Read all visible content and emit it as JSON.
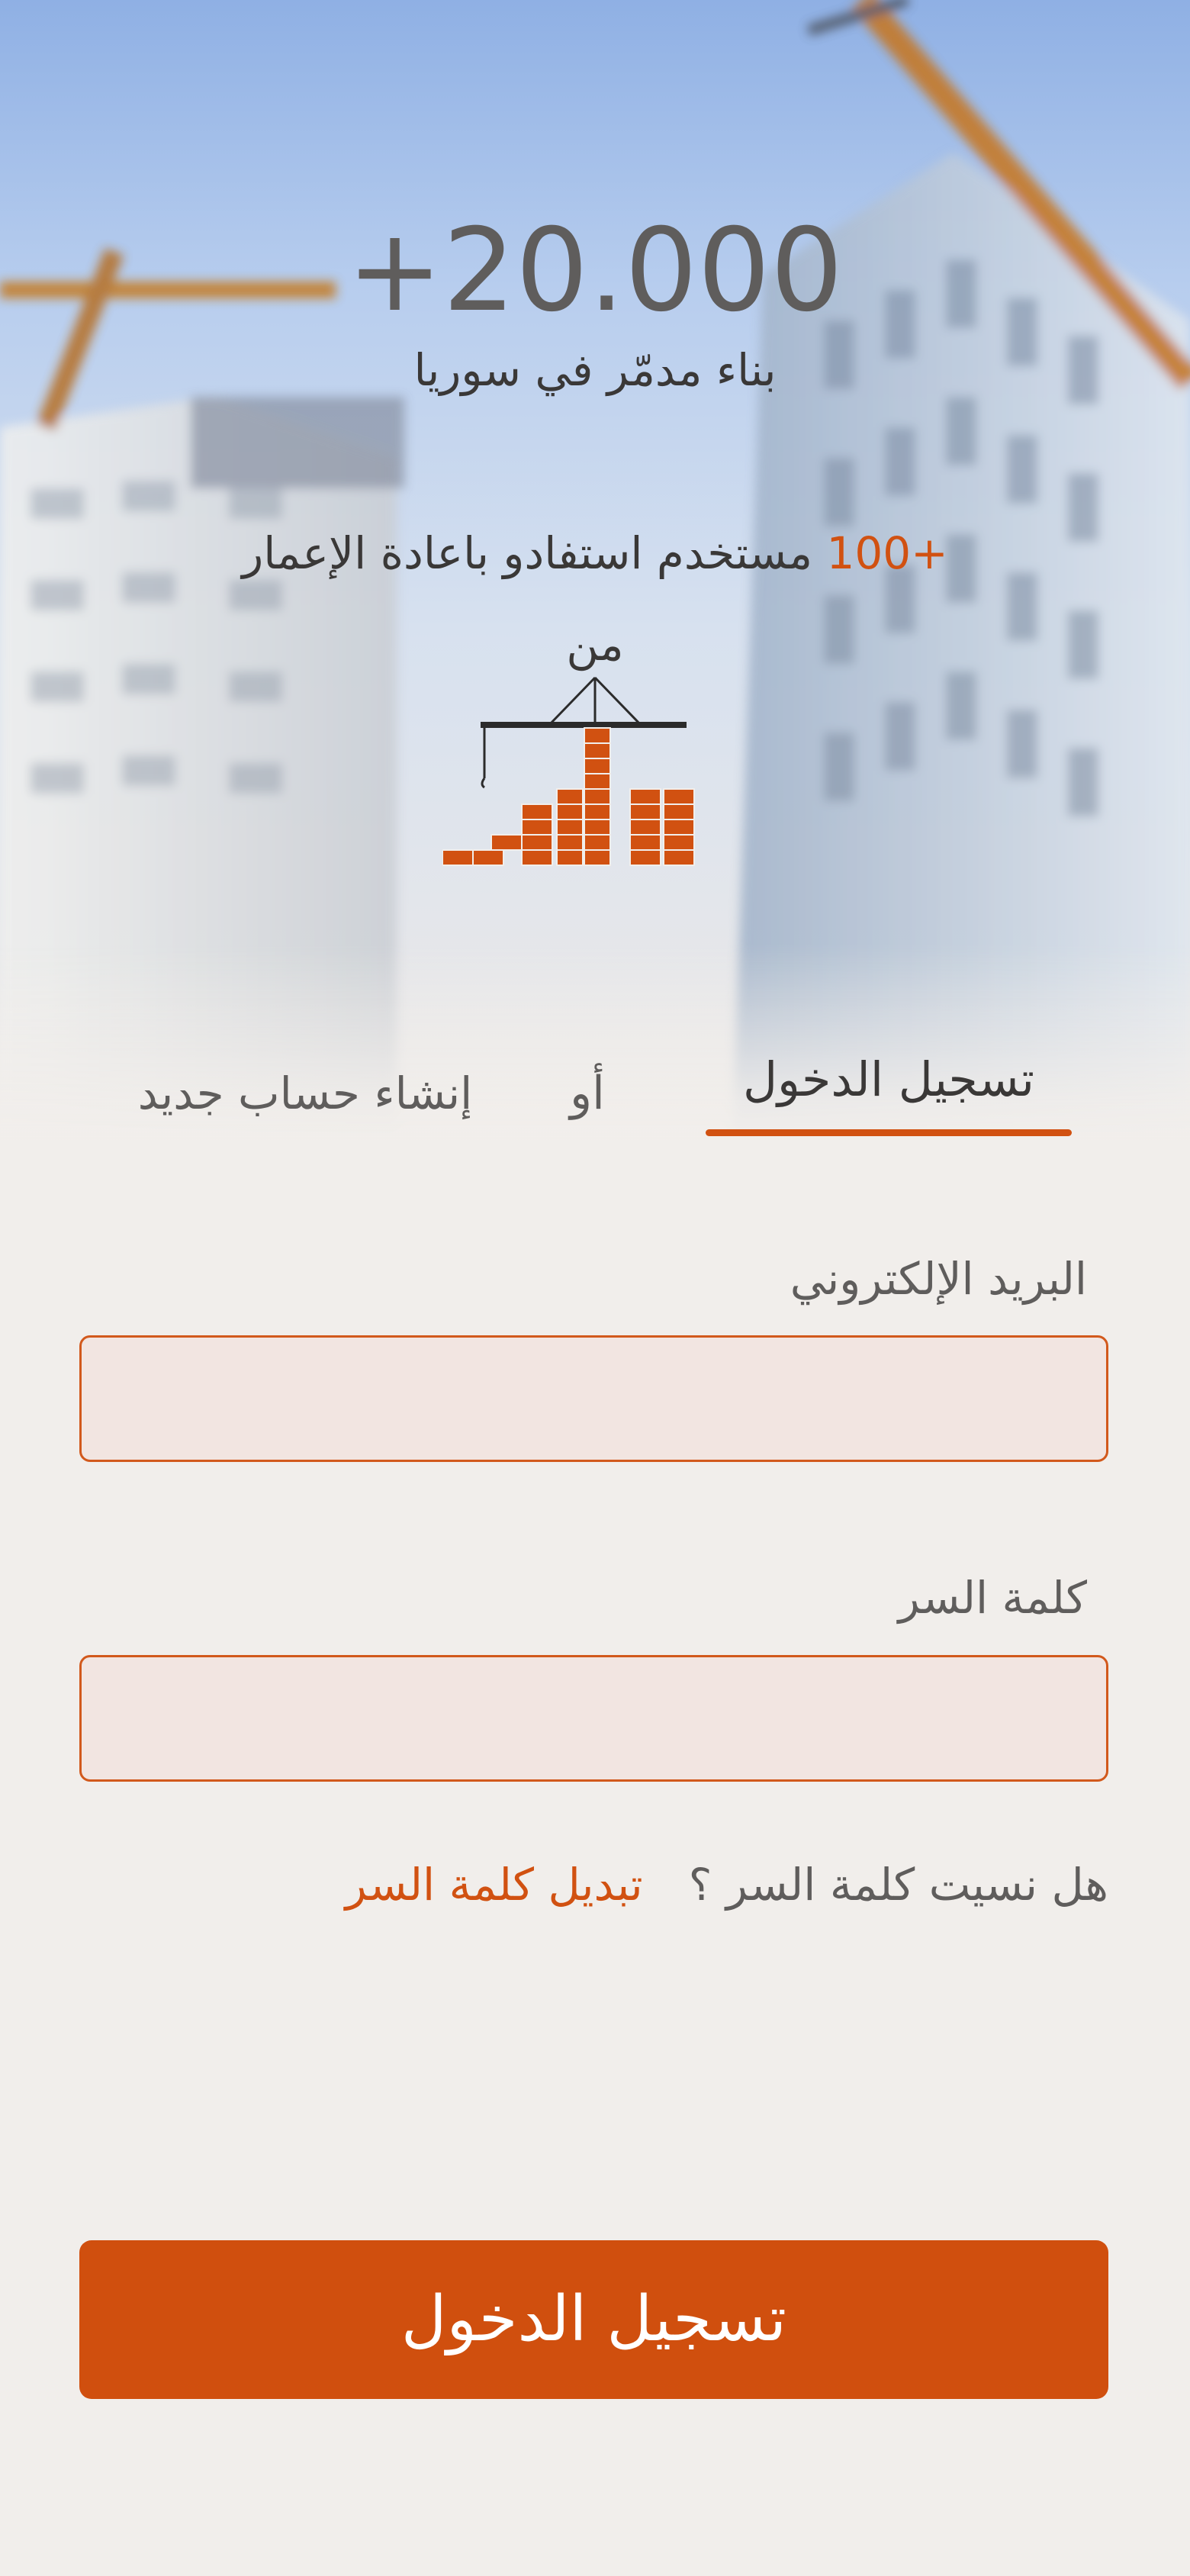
{
  "colors": {
    "accent": "#d15111",
    "text_dark": "#3a3837",
    "text_muted": "#5f5d5c",
    "page_bg": "#f1eeeb",
    "input_bg": "#f2e5e1"
  },
  "hero": {
    "stat_value": "+20.000",
    "stat_caption": "بناء مدمّر في سوريا",
    "users_count": "+100",
    "users_text": " مستخدم استفادو باعادة الإعمار من",
    "background_icon": "construction-site-image",
    "logo_icon": "crane-bricks-logo"
  },
  "tabs": {
    "login": "تسجيل الدخول",
    "or": "أو",
    "register": "إنشاء حساب جديد"
  },
  "form": {
    "email_label": "البريد الإلكتروني",
    "email_value": "",
    "password_label": "كلمة السر",
    "password_value": "",
    "forgot_question": "هل نسيت كلمة السر ؟",
    "forgot_link": "تبديل كلمة السر",
    "submit": "تسجيل الدخول"
  }
}
